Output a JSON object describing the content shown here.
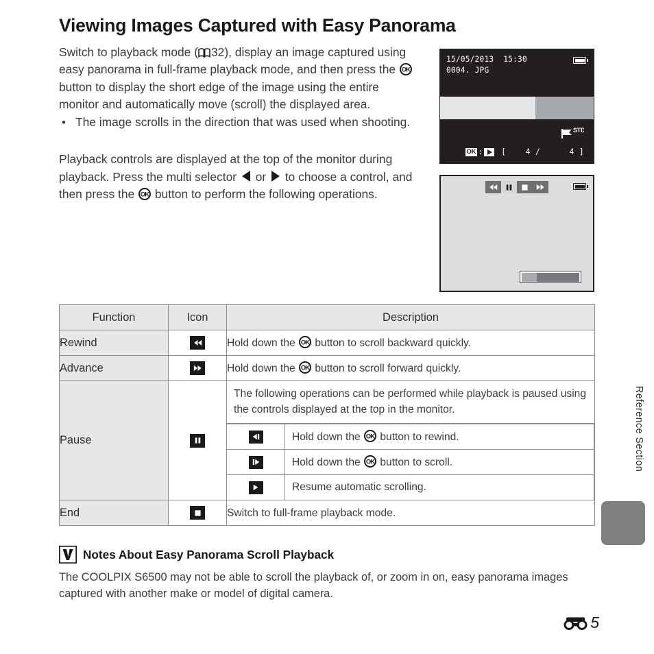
{
  "page": {
    "title": "Viewing Images Captured with Easy Panorama",
    "footer_page_number": "5",
    "footer_icon": "reference-section-icon",
    "side_label": "Reference Section"
  },
  "intro": {
    "part1": "Switch to playback mode (",
    "book_icon": "book-icon",
    "page_ref": "32",
    "part2": "), display an image captured using easy panorama in full-frame playback mode, and then press the ",
    "ok_icon": "ok-button-icon",
    "part3": " button to display the short edge of the image using the entire monitor and automatically move (scroll) the displayed area.",
    "bullets": [
      "The image scrolls in the direction that was used when shooting."
    ]
  },
  "second_para": {
    "part1": "Playback controls are displayed at the top of the monitor during playback. Press the multi selector ",
    "left_icon": "triangle-left-icon",
    "or": " or ",
    "right_icon": "triangle-right-icon",
    "part2": " to choose a control, and then press the ",
    "ok_icon": "ok-button-icon",
    "part3": " button to perform the following operations."
  },
  "monitor_one": {
    "name": "full-frame-playback-monitor",
    "date": "15/05/2013",
    "time": "15:30",
    "filename": "0004. JPG",
    "battery_icon": "battery-icon",
    "quality_flag": "STD",
    "quality_flag_icon": "image-quality-flag-icon",
    "ok_label": "OK",
    "ok_separator": ":",
    "play_icon": "play-icon",
    "frame_counter": "[    4 /      4 ]"
  },
  "monitor_two": {
    "name": "scroll-playback-monitor",
    "battery_icon": "battery-icon",
    "controls": [
      {
        "name": "rewind-control",
        "icon": "rewind-icon",
        "active": false
      },
      {
        "name": "pause-control",
        "icon": "pause-icon",
        "active": true
      },
      {
        "name": "stop-control",
        "icon": "stop-icon",
        "active": false
      },
      {
        "name": "advance-control",
        "icon": "fast-forward-icon",
        "active": false
      }
    ],
    "scroll_indicator": "scroll-position-indicator"
  },
  "table": {
    "headers": {
      "function": "Function",
      "icon": "Icon",
      "description": "Description"
    },
    "rows": [
      {
        "function": "Rewind",
        "icon": "rewind-icon",
        "desc_part1": "Hold down the ",
        "ok_icon": "ok-button-icon",
        "desc_part2": " button to scroll backward quickly."
      },
      {
        "function": "Advance",
        "icon": "fast-forward-icon",
        "desc_part1": "Hold down the ",
        "ok_icon": "ok-button-icon",
        "desc_part2": " button to scroll forward quickly."
      }
    ],
    "pause_row": {
      "function": "Pause",
      "icon": "pause-icon",
      "intro": "The following operations can be performed while playback is paused using the controls displayed at the top in the monitor.",
      "sub_rows": [
        {
          "icon": "step-rewind-icon",
          "desc_part1": "Hold down the ",
          "ok_icon": "ok-button-icon",
          "desc_part2": " button to rewind."
        },
        {
          "icon": "step-forward-icon",
          "desc_part1": "Hold down the ",
          "ok_icon": "ok-button-icon",
          "desc_part2": " button to scroll."
        },
        {
          "icon": "play-icon",
          "desc_part1": "Resume automatic scrolling.",
          "ok_icon": null,
          "desc_part2": ""
        }
      ]
    },
    "end_row": {
      "function": "End",
      "icon": "stop-icon",
      "desc_part1": "Switch to full-frame playback mode.",
      "ok_icon": null,
      "desc_part2": ""
    }
  },
  "notes": {
    "warn_icon": "warning-checkmark-icon",
    "heading": "Notes About Easy Panorama Scroll Playback",
    "body": "The COOLPIX S6500 may not be able to scroll the playback of, or zoom in on, easy panorama images captured with another make or model of digital camera."
  },
  "colors": {
    "monitor_bg": "#231f20",
    "monitor_two_bg": "#dcdddf",
    "table_header_bg": "#e7e7e7",
    "table_border": "#8c8c8c",
    "side_tab": "#808080",
    "text": "#3b3b3b"
  }
}
